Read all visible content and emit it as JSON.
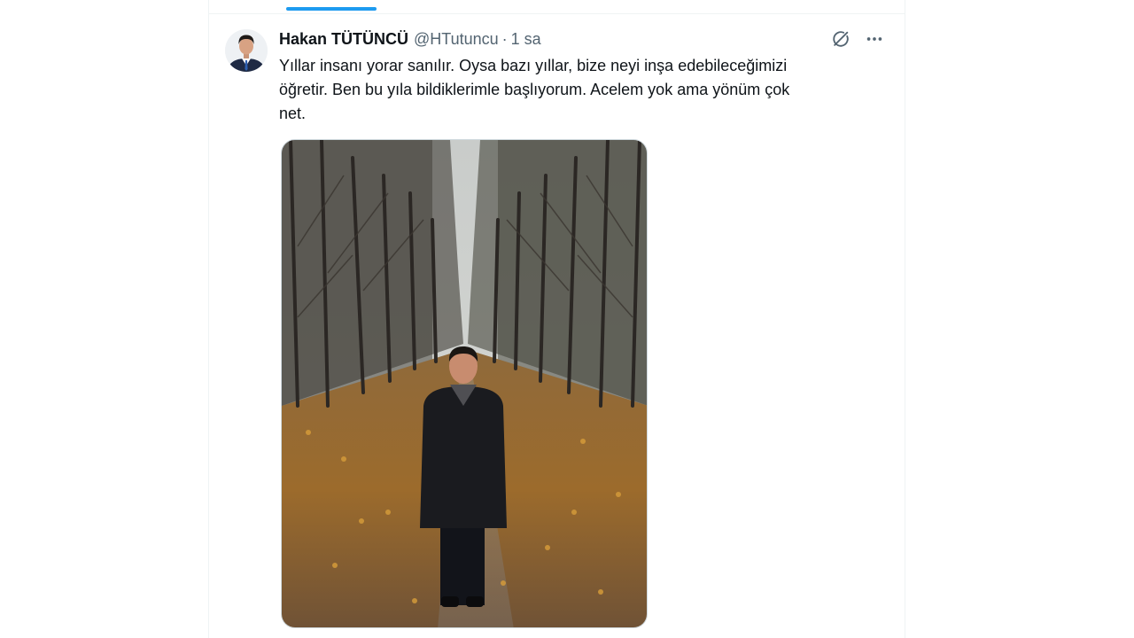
{
  "timeline": {
    "active_tab_color": "#1d9bf0"
  },
  "tweet": {
    "author": {
      "display_name": "Hakan TÜTÜNCÜ",
      "handle": "@HTutuncu",
      "avatar_icon": "profile-photo"
    },
    "separator": "·",
    "time": "1 sa",
    "text_lines": [
      "Yıllar insanı yorar sanılır. Oysa bazı yıllar, bize neyi inşa edebileceğimizi",
      "öğretir. Ben bu yıla bildiklerimle başlıyorum. Acelem yok ama yönüm çok",
      "net."
    ],
    "actions": {
      "grok_icon": "grok-icon",
      "more_icon": "more-options-icon"
    },
    "media": {
      "type": "photo"
    }
  }
}
